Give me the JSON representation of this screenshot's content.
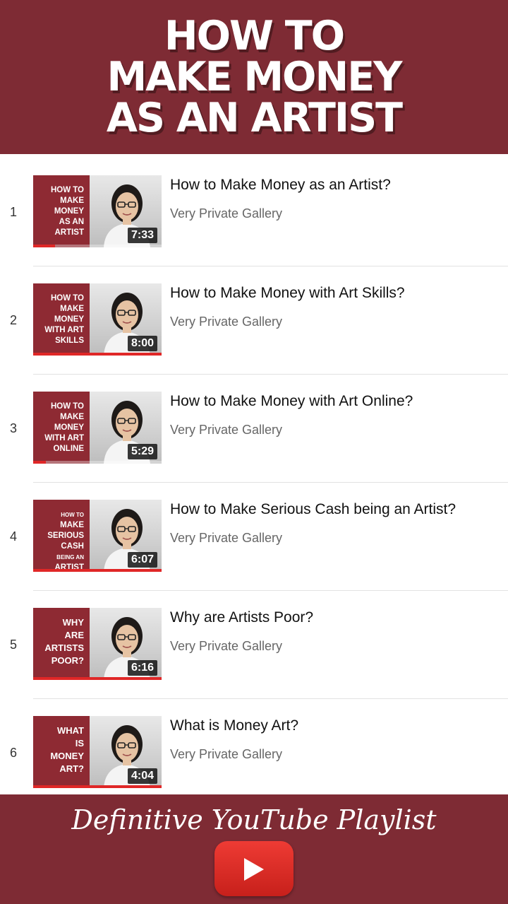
{
  "header": {
    "title_lines": [
      "HOW TO",
      "MAKE MONEY",
      "AS AN ARTIST"
    ]
  },
  "playlist": [
    {
      "index": "1",
      "title": "How to Make Money as an Artist?",
      "channel": "Very Private Gallery",
      "duration": "7:33",
      "thumb_text": [
        "HOW TO",
        "MAKE",
        "MONEY",
        "AS AN",
        "ARTIST"
      ],
      "watched_fraction": 0.17
    },
    {
      "index": "2",
      "title": "How to Make Money with Art Skills?",
      "channel": "Very Private Gallery",
      "duration": "8:00",
      "thumb_text": [
        "HOW TO",
        "MAKE",
        "MONEY",
        "WITH ART",
        "SKILLS"
      ],
      "watched_fraction": 1.0
    },
    {
      "index": "3",
      "title": "How to Make Money with Art Online?",
      "channel": "Very Private Gallery",
      "duration": "5:29",
      "thumb_text": [
        "HOW TO",
        "MAKE",
        "MONEY",
        "WITH ART",
        "ONLINE"
      ],
      "watched_fraction": 0.1
    },
    {
      "index": "4",
      "title": "How to Make Serious Cash being an Artist?",
      "channel": "Very Private Gallery",
      "duration": "6:07",
      "thumb_text": [
        "HOW TO",
        "MAKE",
        "SERIOUS",
        "CASH",
        "BEING AN",
        "ARTIST"
      ],
      "watched_fraction": 1.0
    },
    {
      "index": "5",
      "title": "Why are Artists Poor?",
      "channel": "Very Private Gallery",
      "duration": "6:16",
      "thumb_text": [
        "WHY",
        "ARE",
        "ARTISTS",
        "POOR?"
      ],
      "watched_fraction": 1.0
    },
    {
      "index": "6",
      "title": "What is Money Art?",
      "channel": "Very Private Gallery",
      "duration": "4:04",
      "thumb_text": [
        "WHAT",
        "IS",
        "MONEY",
        "ART?"
      ],
      "watched_fraction": 1.0
    }
  ],
  "footer": {
    "label": "Definitive YouTube Playlist",
    "play_icon": "youtube-play-icon"
  },
  "colors": {
    "brand": "#7e2b34",
    "thumb_panel": "#8e2a33",
    "progress": "#e02727"
  }
}
